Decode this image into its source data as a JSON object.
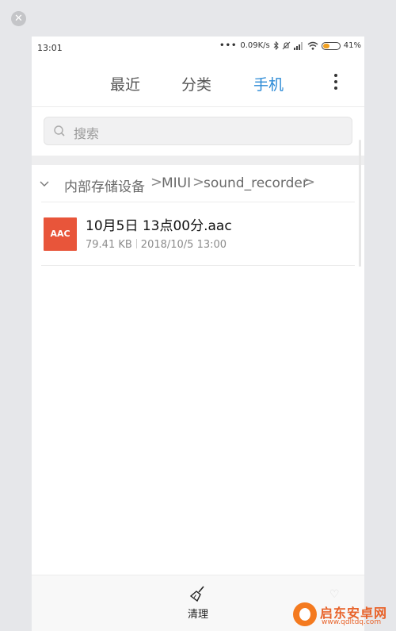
{
  "window": {
    "close_glyph": "✕"
  },
  "status_bar": {
    "time": "13:01",
    "dots": "•••",
    "net_speed": "0.09K/s",
    "battery_level": 0.41,
    "battery_percent": "41%",
    "icons": [
      "bluetooth-icon",
      "silent-icon",
      "signal-icon",
      "wifi-icon",
      "battery-icon"
    ]
  },
  "tabs": [
    {
      "label": "最近",
      "active": false
    },
    {
      "label": "分类",
      "active": false
    },
    {
      "label": "手机",
      "active": true
    }
  ],
  "accent_color": "#2b8ad6",
  "search": {
    "placeholder": "搜索"
  },
  "breadcrumb": {
    "items": [
      "内部存储设备",
      "MIUI",
      "sound_recorder"
    ],
    "separator": ">"
  },
  "files": [
    {
      "thumb_label": "AAC",
      "thumb_color": "#e8553a",
      "name": "10月5日 13点00分.aac",
      "size": "79.41 KB",
      "date": "2018/10/5 13:00"
    }
  ],
  "bottom_bar": {
    "clean_label": "清理"
  },
  "watermark": {
    "title": "启东安卓网",
    "url": "www.qdltdq.com"
  }
}
